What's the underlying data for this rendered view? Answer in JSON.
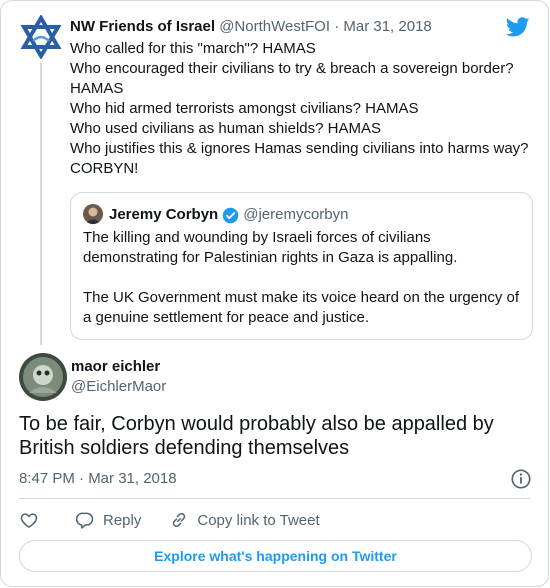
{
  "parent_tweet": {
    "author_name": "NW Friends of Israel",
    "handle": "@NorthWestFOI",
    "separator": "·",
    "date": "Mar 31, 2018",
    "lines": [
      "Who called for this \"march\"? HAMAS",
      "Who encouraged their civilians to try & breach a sovereign border?",
      "HAMAS",
      "Who hid armed terrorists amongst civilians? HAMAS",
      "Who used civilians as human shields? HAMAS",
      "Who justifies this & ignores Hamas sending civilians into harms way?",
      "CORBYN!"
    ]
  },
  "quoted_tweet": {
    "author_name": "Jeremy Corbyn",
    "handle": "@jeremycorbyn",
    "paragraph1": "The killing and wounding by Israeli forces of civilians demonstrating for Palestinian rights in Gaza is appalling.",
    "paragraph2": "The UK Government must make its voice heard on the urgency of a genuine settlement for peace and justice."
  },
  "main_tweet": {
    "author_name": "maor eichler",
    "handle": "@EichlerMaor",
    "text": "To be fair, Corbyn would probably also be appalled by British soldiers defending themselves",
    "timestamp": "8:47 PM · Mar 31, 2018"
  },
  "actions": {
    "reply_label": "Reply",
    "copy_label": "Copy link to Tweet"
  },
  "explore_label": "Explore what's happening on Twitter",
  "colors": {
    "twitter_blue": "#1d9bf0",
    "text": "#0f1419",
    "secondary": "#536471",
    "border": "#cfd9de"
  },
  "icons": [
    "star-of-david-logo-icon",
    "twitter-bird-icon",
    "verified-badge-icon",
    "info-icon",
    "heart-icon",
    "reply-icon",
    "copy-link-icon"
  ]
}
